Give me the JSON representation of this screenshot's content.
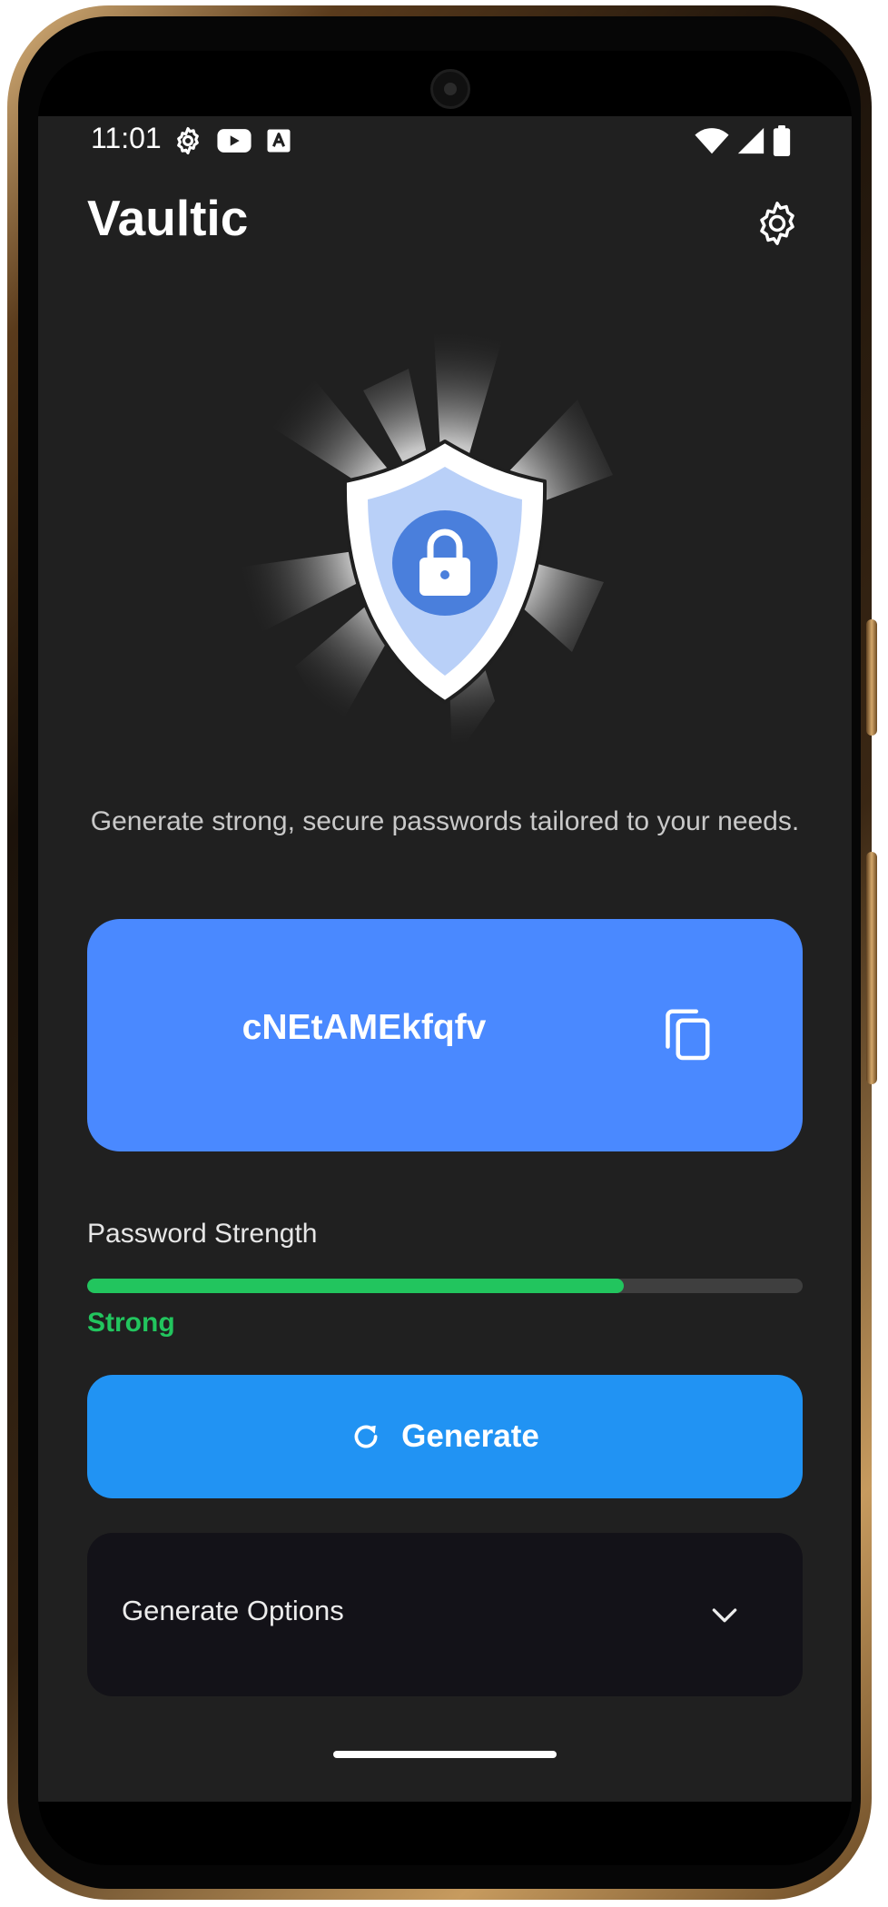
{
  "status_bar": {
    "time": "11:01",
    "left_icons": [
      "gear-icon",
      "youtube-icon",
      "translate-icon"
    ],
    "right_icons": [
      "wifi-icon",
      "cell-signal-icon",
      "battery-icon"
    ]
  },
  "app": {
    "title": "Vaultic",
    "hero_icon": "shield-lock-icon",
    "tagline": "Generate strong, secure passwords tailored to your needs."
  },
  "password_card": {
    "password": "cNEtAMEkfqfv",
    "copy_icon": "copy-icon"
  },
  "strength": {
    "label": "Password Strength",
    "value": "Strong",
    "level": 0.75
  },
  "generate": {
    "label": "Generate",
    "icon": "refresh-icon"
  },
  "options": {
    "label": "Generate Options",
    "icon": "chevron-down-icon"
  },
  "colors": {
    "background": "#202020",
    "card": "#4a89ff",
    "primary_button": "#2193f3",
    "strength_good": "#22c55e",
    "options_panel": "#131218"
  }
}
